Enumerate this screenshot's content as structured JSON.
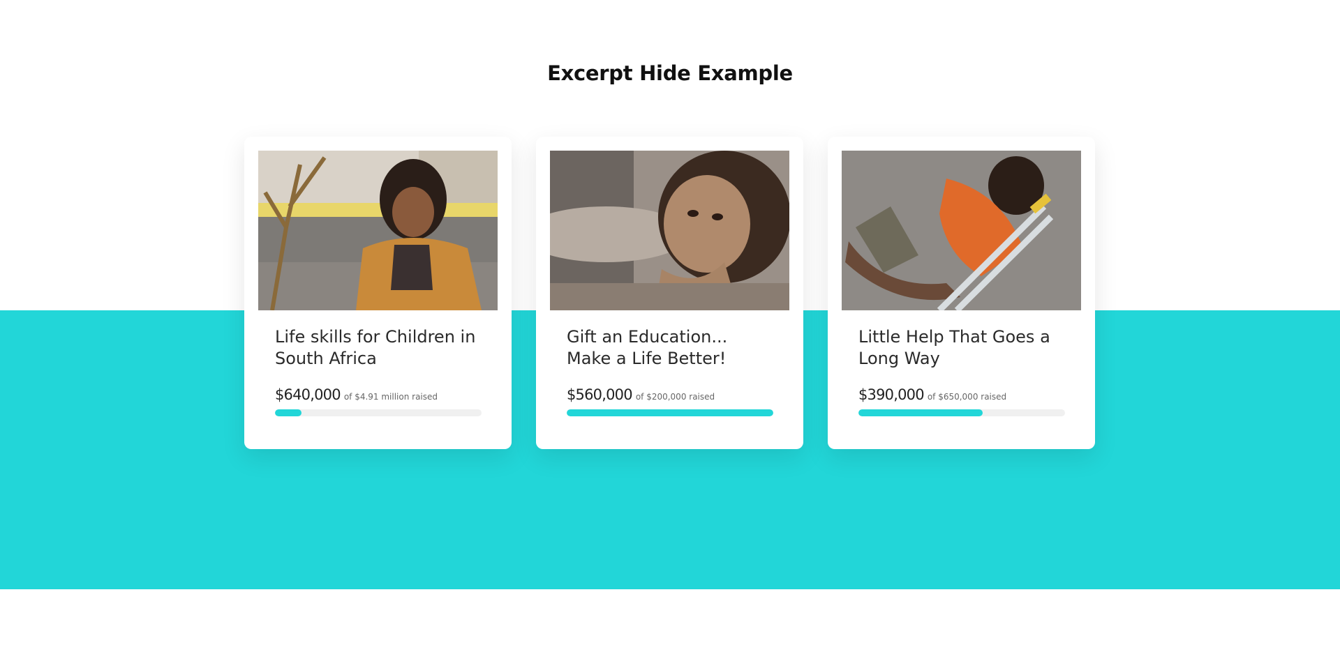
{
  "section": {
    "title": "Excerpt Hide Example"
  },
  "colors": {
    "accent": "#22d6d8",
    "track": "#f0f0f0"
  },
  "cards": [
    {
      "image_icon": "photo-child-by-tree",
      "title": "Life skills for Children in South Africa",
      "raised": "$640,000",
      "goal_text": "of $4.91 million raised",
      "progress_fraction": 0.13
    },
    {
      "image_icon": "photo-girl-resting-chin",
      "title": "Gift an Education... Make a Life Better!",
      "raised": "$560,000",
      "goal_text": "of $200,000 raised",
      "progress_fraction": 1.0
    },
    {
      "image_icon": "photo-boy-with-crutches",
      "title": "Little Help That Goes a Long Way",
      "raised": "$390,000",
      "goal_text": "of $650,000 raised",
      "progress_fraction": 0.6
    }
  ]
}
